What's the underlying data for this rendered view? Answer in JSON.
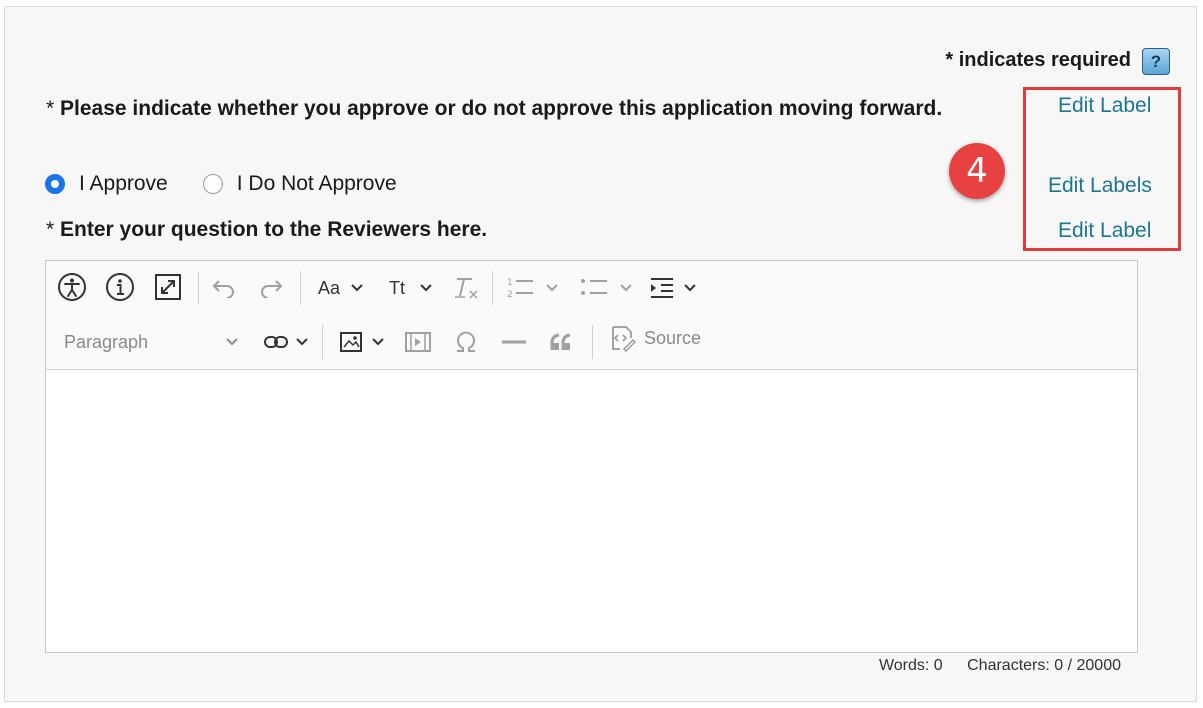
{
  "required_note": "* indicates required",
  "help_button": "?",
  "question1": {
    "star": "* ",
    "text": "Please indicate whether you approve or do not approve this application moving forward."
  },
  "radio_options": {
    "approve": "I Approve",
    "not_approve": "I Do Not Approve",
    "selected": "I Approve"
  },
  "question2": {
    "star": "* ",
    "text": "Enter your question to the Reviewers here."
  },
  "edit_links": {
    "label1": "Edit Label",
    "labels": "Edit Labels",
    "label2": "Edit Label"
  },
  "callout_number": "4",
  "callout_color": "#e84141",
  "editor": {
    "paragraph_select": "Paragraph",
    "source_label": "Source",
    "font_family_label": "Aa",
    "font_size_label": "Tt",
    "toolbar_icons": [
      "accessibility-icon",
      "info-icon",
      "fullscreen-icon",
      "undo-icon",
      "redo-icon",
      "font-family-icon",
      "font-size-icon",
      "remove-format-icon",
      "numbered-list-icon",
      "bulleted-list-icon",
      "indent-icon",
      "link-icon",
      "image-icon",
      "media-icon",
      "special-characters-icon",
      "horizontal-line-icon",
      "blockquote-icon",
      "source-icon"
    ]
  },
  "word_count": "Words: 0",
  "char_count": "Characters: 0 / 20000",
  "accent_color": "#1a73e8",
  "link_color": "#1e7591"
}
